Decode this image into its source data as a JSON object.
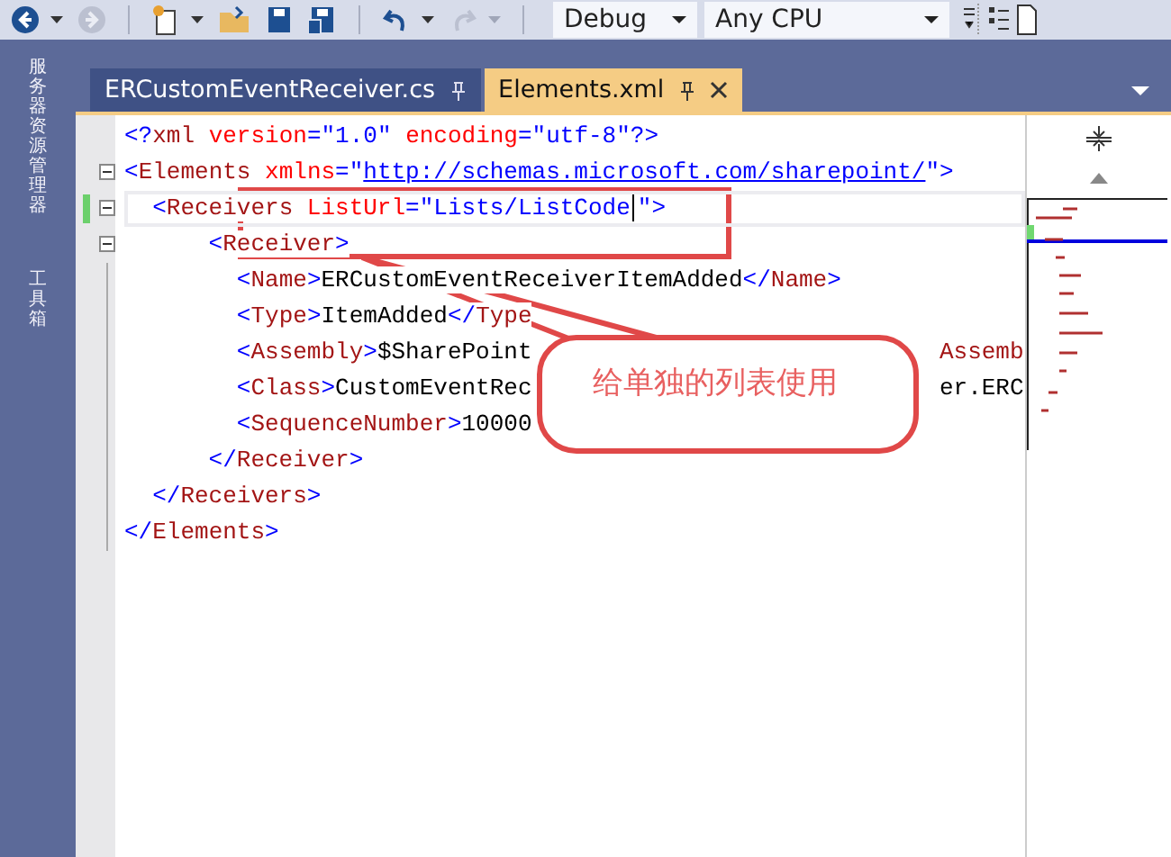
{
  "toolbar": {
    "buttons": [
      {
        "kind": "back",
        "disabled": false
      },
      {
        "kind": "forward",
        "disabled": true
      },
      {
        "kind": "new",
        "disabled": false
      },
      {
        "kind": "open",
        "disabled": false
      },
      {
        "kind": "save",
        "disabled": false
      },
      {
        "kind": "saveall",
        "disabled": false
      },
      {
        "kind": "undo",
        "disabled": false
      },
      {
        "kind": "redo",
        "disabled": true
      }
    ],
    "configuration": "Debug",
    "platform": "Any CPU"
  },
  "side_tabs": [
    "服务器资源管理器",
    "工具箱"
  ],
  "tabs": [
    {
      "label": "ERCustomEventReceiver.cs",
      "selected": false
    },
    {
      "label": "Elements.xml",
      "selected": true
    }
  ],
  "code": [
    {
      "tokens": [
        {
          "kind": "punct",
          "text": "<?"
        },
        {
          "kind": "name",
          "text": "xml"
        },
        {
          "kind": "attr",
          "text": " version"
        },
        {
          "kind": "punct",
          "text": "="
        },
        {
          "kind": "value",
          "text": "\"1.0\""
        },
        {
          "kind": "attr",
          "text": " encoding"
        },
        {
          "kind": "punct",
          "text": "="
        },
        {
          "kind": "value",
          "text": "\"utf-8\""
        },
        {
          "kind": "punct",
          "text": "?>"
        }
      ]
    },
    {
      "expanded": true,
      "tokens": [
        {
          "kind": "punct",
          "text": "<"
        },
        {
          "kind": "name",
          "text": "Elements"
        },
        {
          "kind": "attr",
          "text": " xmlns"
        },
        {
          "kind": "punct",
          "text": "=\""
        },
        {
          "kind": "link",
          "text": "http://schemas.microsoft.com/sharepoint/"
        },
        {
          "kind": "punct",
          "text": "\">"
        }
      ],
      "children": [
        {
          "expanded": true,
          "changed": true,
          "current": true,
          "tokens": [
            {
              "kind": "punct",
              "text": "<"
            },
            {
              "kind": "name",
              "text": "Receivers"
            },
            {
              "kind": "attr",
              "text": " ListUrl"
            },
            {
              "kind": "punct",
              "text": "="
            },
            {
              "kind": "value",
              "text": "\"Lists/ListCode"
            },
            {
              "kind": "caret"
            },
            {
              "kind": "value",
              "text": "\""
            },
            {
              "kind": "punct",
              "text": ">"
            }
          ],
          "children": [
            {
              "expanded": true,
              "tokens": [
                {
                  "kind": "punct",
                  "text": "<"
                },
                {
                  "kind": "name",
                  "text": "Receiver"
                },
                {
                  "kind": "punct",
                  "text": ">"
                }
              ],
              "children": [
                {
                  "tokens": [
                    {
                      "kind": "punct",
                      "text": "<"
                    },
                    {
                      "kind": "name",
                      "text": "Name"
                    },
                    {
                      "kind": "punct",
                      "text": ">"
                    },
                    {
                      "kind": "text",
                      "text": "ERCustomEventReceiverItemAdded"
                    },
                    {
                      "kind": "punct",
                      "text": "</"
                    },
                    {
                      "kind": "name",
                      "text": "Name"
                    },
                    {
                      "kind": "punct",
                      "text": ">"
                    }
                  ]
                },
                {
                  "tokens": [
                    {
                      "kind": "punct",
                      "text": "<"
                    },
                    {
                      "kind": "name",
                      "text": "Type"
                    },
                    {
                      "kind": "punct",
                      "text": ">"
                    },
                    {
                      "kind": "text",
                      "text": "ItemAdded"
                    },
                    {
                      "kind": "punct",
                      "text": "</"
                    },
                    {
                      "kind": "name",
                      "text": "Type"
                    }
                  ]
                },
                {
                  "tokens": [
                    {
                      "kind": "punct",
                      "text": "<"
                    },
                    {
                      "kind": "name",
                      "text": "Assembly"
                    },
                    {
                      "kind": "punct",
                      "text": ">"
                    },
                    {
                      "kind": "text",
                      "text": "$SharePoint"
                    }
                  ],
                  "tail": [
                    {
                      "kind": "name",
                      "text": "Assemb"
                    }
                  ]
                },
                {
                  "tokens": [
                    {
                      "kind": "punct",
                      "text": "<"
                    },
                    {
                      "kind": "name",
                      "text": "Class"
                    },
                    {
                      "kind": "punct",
                      "text": ">"
                    },
                    {
                      "kind": "text",
                      "text": "CustomEventRec"
                    }
                  ],
                  "tail": [
                    {
                      "kind": "text",
                      "text": "er.ERC"
                    }
                  ]
                },
                {
                  "tokens": [
                    {
                      "kind": "punct",
                      "text": "<"
                    },
                    {
                      "kind": "name",
                      "text": "SequenceNumber"
                    },
                    {
                      "kind": "punct",
                      "text": ">"
                    },
                    {
                      "kind": "text",
                      "text": "10000"
                    }
                  ]
                }
              ],
              "close": [
                {
                  "kind": "punct",
                  "text": "</"
                },
                {
                  "kind": "name",
                  "text": "Receiver"
                },
                {
                  "kind": "punct",
                  "text": ">"
                }
              ]
            }
          ],
          "close": [
            {
              "kind": "punct",
              "text": "</"
            },
            {
              "kind": "name",
              "text": "Receivers"
            },
            {
              "kind": "punct",
              "text": ">"
            }
          ]
        }
      ],
      "close": [
        {
          "kind": "punct",
          "text": "</"
        },
        {
          "kind": "name",
          "text": "Elements"
        },
        {
          "kind": "punct",
          "text": ">"
        }
      ]
    }
  ],
  "callout": {
    "text": "给单独的列表使用"
  }
}
